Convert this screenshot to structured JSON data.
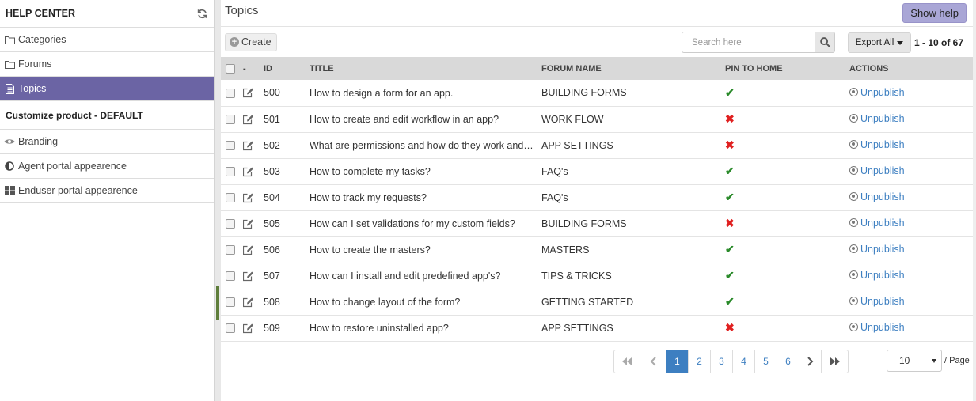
{
  "sidebar": {
    "title": "HELP CENTER",
    "items": [
      {
        "label": "Categories"
      },
      {
        "label": "Forums"
      },
      {
        "label": "Topics"
      }
    ],
    "section_title": "Customize product - DEFAULT",
    "custom_items": [
      {
        "label": "Branding"
      },
      {
        "label": "Agent portal appearence"
      },
      {
        "label": "Enduser portal appearence"
      }
    ]
  },
  "header": {
    "title": "Topics",
    "show_help": "Show help"
  },
  "toolbar": {
    "create_label": "Create",
    "search_placeholder": "Search here",
    "export_label": "Export All",
    "range": "1 - 10 of 67"
  },
  "table": {
    "columns": {
      "dash": "-",
      "id": "ID",
      "title": "TITLE",
      "forum": "FORUM NAME",
      "pin": "PIN TO HOME",
      "actions": "ACTIONS"
    },
    "action_label": "Unpublish",
    "rows": [
      {
        "id": "500",
        "title": "How to design a form for an app.",
        "forum": "BUILDING FORMS",
        "pinned": true
      },
      {
        "id": "501",
        "title": "How to create and edit workflow in an app?",
        "forum": "WORK FLOW",
        "pinned": false
      },
      {
        "id": "502",
        "title": "What are permissions and how do they work and how to use them?",
        "forum": "APP SETTINGS",
        "pinned": false
      },
      {
        "id": "503",
        "title": "How to complete my tasks?",
        "forum": "FAQ's",
        "pinned": true
      },
      {
        "id": "504",
        "title": "How to track my requests?",
        "forum": "FAQ's",
        "pinned": true
      },
      {
        "id": "505",
        "title": "How can I set validations for my custom fields?",
        "forum": "BUILDING FORMS",
        "pinned": false
      },
      {
        "id": "506",
        "title": "How to create the masters?",
        "forum": "MASTERS",
        "pinned": true
      },
      {
        "id": "507",
        "title": "How can I install and edit predefined app's?",
        "forum": "TIPS & TRICKS",
        "pinned": true
      },
      {
        "id": "508",
        "title": "How to change layout of the form?",
        "forum": "GETTING STARTED",
        "pinned": true
      },
      {
        "id": "509",
        "title": "How to restore uninstalled app?",
        "forum": "APP SETTINGS",
        "pinned": false
      }
    ]
  },
  "pagination": {
    "pages": [
      "1",
      "2",
      "3",
      "4",
      "5",
      "6"
    ],
    "current": "1",
    "per_page": "10",
    "per_page_label": "/ Page"
  },
  "colors": {
    "active_nav": "#6b64a4",
    "link": "#3d7fc1",
    "pin_yes": "#2a8a2a",
    "pin_no": "#e02020"
  }
}
